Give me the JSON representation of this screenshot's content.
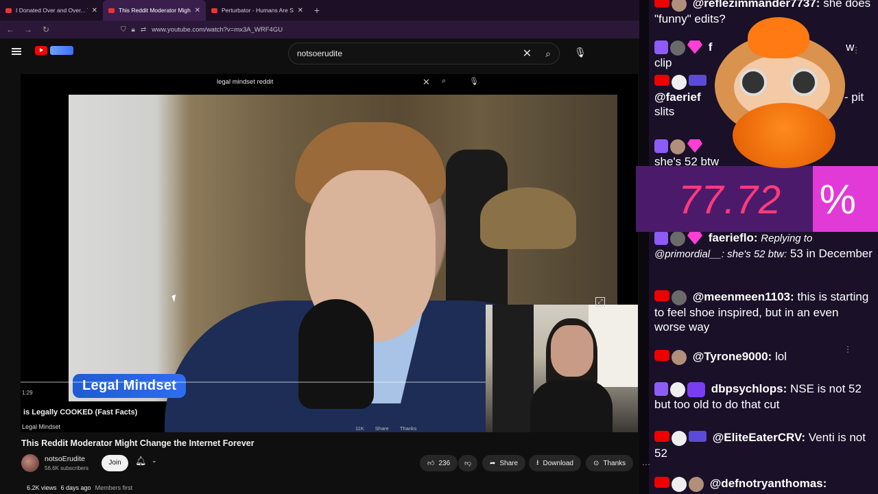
{
  "browser": {
    "tabs": [
      {
        "title": "I Donated Over and Over... To S",
        "active": false
      },
      {
        "title": "This Reddit Moderator Might Ch",
        "active": true
      },
      {
        "title": "Perturbator - Humans Are Such",
        "active": false
      }
    ],
    "url": "www.youtube.com/watch?v=mx3A_WRF4GU"
  },
  "youtube": {
    "search_query": "notsoerudite",
    "video": {
      "inner_search_query": "legal mindset reddit",
      "name_tag": "Legal Mindset",
      "timestamp": "1:29",
      "inner_title": "is Legally COOKED (Fast Facts)",
      "inner_channel": "Legal Mindset",
      "inner_actions": [
        "11K",
        "",
        "Share",
        "Thanks"
      ]
    },
    "title": "This Reddit Moderator Might Change the Internet Forever",
    "channel": {
      "name": "notsoErudite",
      "subscribers": "56.6K subscribers",
      "join_label": "Join"
    },
    "actions": {
      "likes": "236",
      "share": "Share",
      "download": "Download",
      "thanks": "Thanks"
    },
    "stats": {
      "views": "6.2K views",
      "age": "6 days ago",
      "members": "Members first"
    }
  },
  "overlay": {
    "percent_value": "77.72",
    "percent_sign": "%"
  },
  "chat": {
    "messages": [
      {
        "user": "@reflezimmander7737:",
        "text": "she does \"funny\" edits?"
      },
      {
        "user": "f",
        "text": "w clip"
      },
      {
        "user": "@faerief",
        "text": "rm - pit slits"
      },
      {
        "user": "",
        "text": "she's 52 btw"
      },
      {
        "user": "faerieflo:",
        "reply": "Replying to @primordial__: she's 52 btw:",
        "text": "53 in December"
      },
      {
        "user": "@meenmeen1103:",
        "text": "this is starting to feel shoe inspired, but in an even worse way"
      },
      {
        "user": "@Tyrone9000:",
        "text": "lol"
      },
      {
        "user": "dbpsychlops:",
        "text": "NSE is not 52 but too old to do that cut"
      },
      {
        "user": "@EliteEaterCRV:",
        "text": "Venti is not 52"
      },
      {
        "user": "@defnotryanthomas:",
        "text": ""
      }
    ]
  }
}
